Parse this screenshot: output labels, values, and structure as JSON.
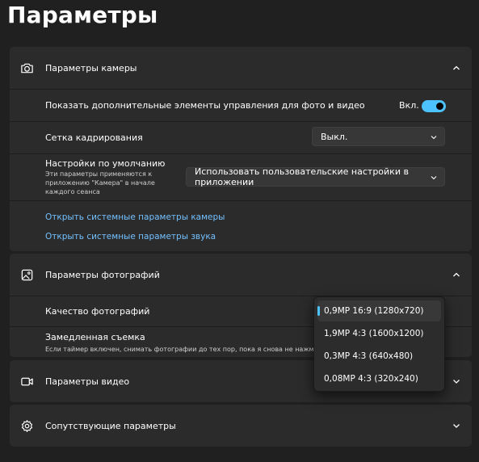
{
  "page_title": "Параметры",
  "colors": {
    "accent": "#4cc2ff",
    "link": "#73c0ff",
    "background": "#202020",
    "card": "#2b2b2b"
  },
  "camera": {
    "title": "Параметры камеры",
    "icon": "camera-icon",
    "expanded": true,
    "extended_controls": {
      "label": "Показать дополнительные элементы управления для фото и видео",
      "state_label": "Вкл.",
      "on": true
    },
    "framing_grid": {
      "label": "Сетка кадрирования",
      "value": "Выкл."
    },
    "defaults": {
      "label": "Настройки по умолчанию",
      "sub_line1": "Эти параметры применяются к",
      "sub_line2": "приложению \"Камера\" в начале",
      "sub_line3": "каждого сеанса",
      "value": "Использовать пользовательские настройки в приложении"
    },
    "links": {
      "camera_settings": "Открыть системные параметры камеры",
      "sound_settings": "Открыть системные параметры звука"
    }
  },
  "photo": {
    "title": "Параметры фотографий",
    "icon": "image-icon",
    "expanded": true,
    "quality_label": "Качество фотографий",
    "timelapse_label": "Замедленная съемка",
    "timelapse_sub": "Если таймер включен, снимать фотографии до тех пор, пока я снова не нажму к"
  },
  "quality_dropdown": {
    "selected_index": 0,
    "options": [
      "0,9MP 16:9 (1280x720)",
      "1,9MP 4:3 (1600x1200)",
      "0,3MP 4:3 (640x480)",
      "0,08MP 4:3 (320x240)"
    ]
  },
  "video": {
    "title": "Параметры видео",
    "icon": "video-camera-icon",
    "expanded": false
  },
  "related": {
    "title": "Сопутствующие параметры",
    "icon": "gear-icon",
    "expanded": false
  }
}
